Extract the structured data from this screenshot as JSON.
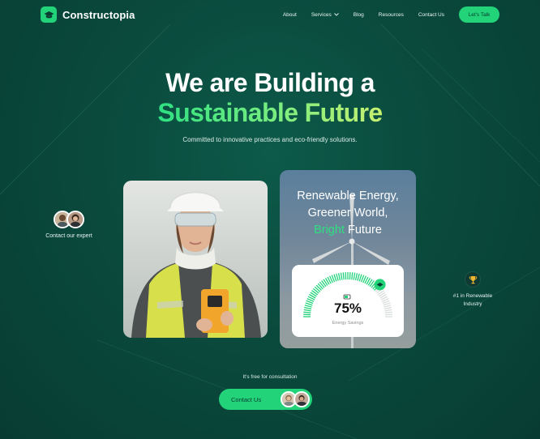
{
  "brand": {
    "name": "Constructopia",
    "accent": "#22d37a",
    "background": "#0a4a3d"
  },
  "nav": {
    "items": [
      {
        "label": "About"
      },
      {
        "label": "Services",
        "has_dropdown": true
      },
      {
        "label": "Blog"
      },
      {
        "label": "Resources"
      },
      {
        "label": "Contact Us"
      }
    ],
    "cta_label": "Let's Talk"
  },
  "hero": {
    "title_line1": "We are Building a",
    "title_line2": "Sustainable Future",
    "subtitle": "Committed to innovative practices and eco-friendly solutions."
  },
  "expert": {
    "label": "Contact our expert"
  },
  "energy_card": {
    "line1": "Renewable Energy,",
    "line2": "Greener World,",
    "line3_highlight": "Bright",
    "line3_rest": " Future",
    "gauge_value": "75%",
    "gauge_fraction": 0.75,
    "gauge_label": "Energy Savings"
  },
  "award": {
    "label": "#1 in Renewable Industry",
    "icon": "trophy-icon"
  },
  "consultation": {
    "note": "It's free for consultation",
    "button_label": "Contact Us"
  }
}
